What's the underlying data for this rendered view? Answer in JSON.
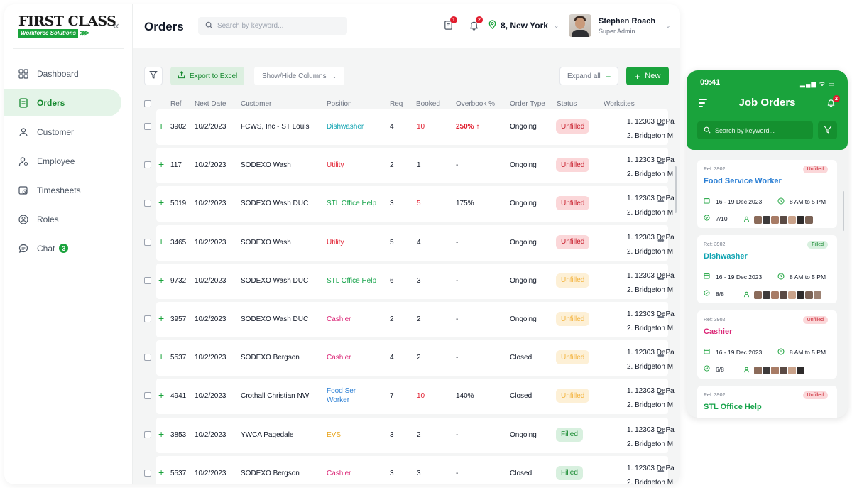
{
  "brand": {
    "logo_main": "FIRST CLASS",
    "logo_sub": "Workforce Solutions",
    "colors": {
      "primary": "#1aa33c",
      "danger": "#e11d2e",
      "warning": "#f3b33d"
    }
  },
  "sidebar": {
    "collapse_icon": "double-chevron-left-icon",
    "items": [
      {
        "label": "Dashboard",
        "icon": "grid-icon"
      },
      {
        "label": "Orders",
        "icon": "orders-icon",
        "active": true
      },
      {
        "label": "Customer",
        "icon": "user-icon"
      },
      {
        "label": "Employee",
        "icon": "employee-icon"
      },
      {
        "label": "Timesheets",
        "icon": "timesheet-icon"
      },
      {
        "label": "Roles",
        "icon": "roles-icon"
      },
      {
        "label": "Chat",
        "icon": "chat-icon",
        "badge": "3"
      }
    ]
  },
  "header": {
    "title": "Orders",
    "search_placeholder": "Search by keyword...",
    "doc_badge": "1",
    "bell_badge": "2",
    "location": "8, New York",
    "user_name": "Stephen Roach",
    "user_role": "Super Admin"
  },
  "toolbar": {
    "export_label": "Export to Excel",
    "columns_label": "Show/Hide Columns",
    "expand_label": "Expand all",
    "new_label": "New"
  },
  "table": {
    "columns": {
      "ref": "Ref",
      "next_date": "Next Date",
      "customer": "Customer",
      "position": "Position",
      "req": "Req",
      "booked": "Booked",
      "overbook": "Overbook %",
      "order_type": "Order Type",
      "status": "Status",
      "worksites": "Worksites"
    },
    "rows": [
      {
        "ref": "3902",
        "date": "10/2/2023",
        "customer": "FCWS, Inc - ST Louis",
        "position": "Dishwasher",
        "pos_color": "#0fa3b1",
        "req": "4",
        "booked": "10",
        "booked_red": true,
        "overbook": "250%",
        "overbook_red": true,
        "overbook_arrow": "↑",
        "type": "Ongoing",
        "status": "Unfilled",
        "status_kind": "unfilled",
        "ws1": "1. 12303 DePa",
        "ws2": "2. Bridgeton M"
      },
      {
        "ref": "117",
        "date": "10/2/2023",
        "customer": "SODEXO Wash",
        "position": "Utility",
        "pos_color": "#e11d2e",
        "req": "2",
        "booked": "1",
        "booked_red": false,
        "overbook": "-",
        "overbook_red": false,
        "overbook_arrow": "",
        "type": "Ongoing",
        "status": "Unfilled",
        "status_kind": "unfilled",
        "ws1": "1. 12303 DePa",
        "ws2": "2. Bridgeton M"
      },
      {
        "ref": "5019",
        "date": "10/2/2023",
        "customer": "SODEXO Wash DUC",
        "position": "STL Office Help",
        "pos_color": "#16a34a",
        "req": "3",
        "booked": "5",
        "booked_red": true,
        "overbook": "175%",
        "overbook_red": false,
        "overbook_arrow": "",
        "type": "Ongoing",
        "status": "Unfilled",
        "status_kind": "unfilled",
        "ws1": "1. 12303 DePa",
        "ws2": "2. Bridgeton M"
      },
      {
        "ref": "3465",
        "date": "10/2/2023",
        "customer": "SODEXO Wash",
        "position": "Utility",
        "pos_color": "#e11d2e",
        "req": "5",
        "booked": "4",
        "booked_red": false,
        "overbook": "-",
        "overbook_red": false,
        "overbook_arrow": "",
        "type": "Ongoing",
        "status": "Unfilled",
        "status_kind": "unfilled",
        "ws1": "1. 12303 DePa",
        "ws2": "2. Bridgeton M"
      },
      {
        "ref": "9732",
        "date": "10/2/2023",
        "customer": "SODEXO Wash DUC",
        "position": "STL Office Help",
        "pos_color": "#16a34a",
        "req": "6",
        "booked": "3",
        "booked_red": false,
        "overbook": "-",
        "overbook_red": false,
        "overbook_arrow": "",
        "type": "Ongoing",
        "status": "Unfilled",
        "status_kind": "pending",
        "ws1": "1. 12303 DePa",
        "ws2": "2. Bridgeton M"
      },
      {
        "ref": "3957",
        "date": "10/2/2023",
        "customer": "SODEXO Wash DUC",
        "position": "Cashier",
        "pos_color": "#db2777",
        "req": "2",
        "booked": "2",
        "booked_red": false,
        "overbook": "-",
        "overbook_red": false,
        "overbook_arrow": "",
        "type": "Ongoing",
        "status": "Unfilled",
        "status_kind": "pending",
        "ws1": "1. 12303 DePa",
        "ws2": "2. Bridgeton M"
      },
      {
        "ref": "5537",
        "date": "10/2/2023",
        "customer": "SODEXO Bergson",
        "position": "Cashier",
        "pos_color": "#db2777",
        "req": "4",
        "booked": "2",
        "booked_red": false,
        "overbook": "-",
        "overbook_red": false,
        "overbook_arrow": "",
        "type": "Closed",
        "status": "Unfilled",
        "status_kind": "pending",
        "ws1": "1. 12303 DePa",
        "ws2": "2. Bridgeton M"
      },
      {
        "ref": "4941",
        "date": "10/2/2023",
        "customer": "Crothall Christian NW",
        "position": "Food Ser Worker",
        "pos_color": "#2b7fd4",
        "pos_wrap": true,
        "req": "7",
        "booked": "10",
        "booked_red": true,
        "overbook": "140%",
        "overbook_red": false,
        "overbook_arrow": "",
        "type": "Closed",
        "status": "Unfilled",
        "status_kind": "pending",
        "ws1": "1. 12303 DePa",
        "ws2": "2. Bridgeton M"
      },
      {
        "ref": "3853",
        "date": "10/2/2023",
        "customer": "YWCA Pagedale",
        "position": "EVS",
        "pos_color": "#e8a317",
        "req": "3",
        "booked": "2",
        "booked_red": false,
        "overbook": "-",
        "overbook_red": false,
        "overbook_arrow": "",
        "type": "Ongoing",
        "status": "Filled",
        "status_kind": "filled",
        "ws1": "1. 12303 DePa",
        "ws2": "2. Bridgeton M"
      },
      {
        "ref": "5537",
        "date": "10/2/2023",
        "customer": "SODEXO Bergson",
        "position": "Cashier",
        "pos_color": "#db2777",
        "req": "3",
        "booked": "3",
        "booked_red": false,
        "overbook": "-",
        "overbook_red": false,
        "overbook_arrow": "",
        "type": "Closed",
        "status": "Filled",
        "status_kind": "filled",
        "ws1": "1. 12303 DePa",
        "ws2": "2. Bridgeton M"
      }
    ]
  },
  "phone": {
    "time": "09:41",
    "status_icons": "▂▄▆ ᯤ ▭",
    "title": "Job Orders",
    "bell_badge": "2",
    "search_placeholder": "Search by keyword...",
    "cards": [
      {
        "ref": "Ref: 3902",
        "status": "Unfilled",
        "status_kind": "unfilled",
        "title": "Food Service Worker",
        "title_color": "#2b7fd4",
        "dates": "16 - 19 Dec 2023",
        "time": "8 AM to 5 PM",
        "count": "7/10",
        "faces": 7
      },
      {
        "ref": "Ref: 3902",
        "status": "Filled",
        "status_kind": "filled",
        "title": "Dishwasher",
        "title_color": "#0fa3b1",
        "dates": "16 - 19 Dec 2023",
        "time": "8 AM to 5 PM",
        "count": "8/8",
        "faces": 8
      },
      {
        "ref": "Ref: 3902",
        "status": "Unfilled",
        "status_kind": "unfilled",
        "title": "Cashier",
        "title_color": "#db2777",
        "dates": "16 - 19 Dec 2023",
        "time": "8 AM to 5 PM",
        "count": "6/8",
        "faces": 6
      },
      {
        "ref": "Ref: 3902",
        "status": "Unfilled",
        "status_kind": "unfilled",
        "title": "STL Office Help",
        "title_color": "#16a34a"
      }
    ]
  }
}
